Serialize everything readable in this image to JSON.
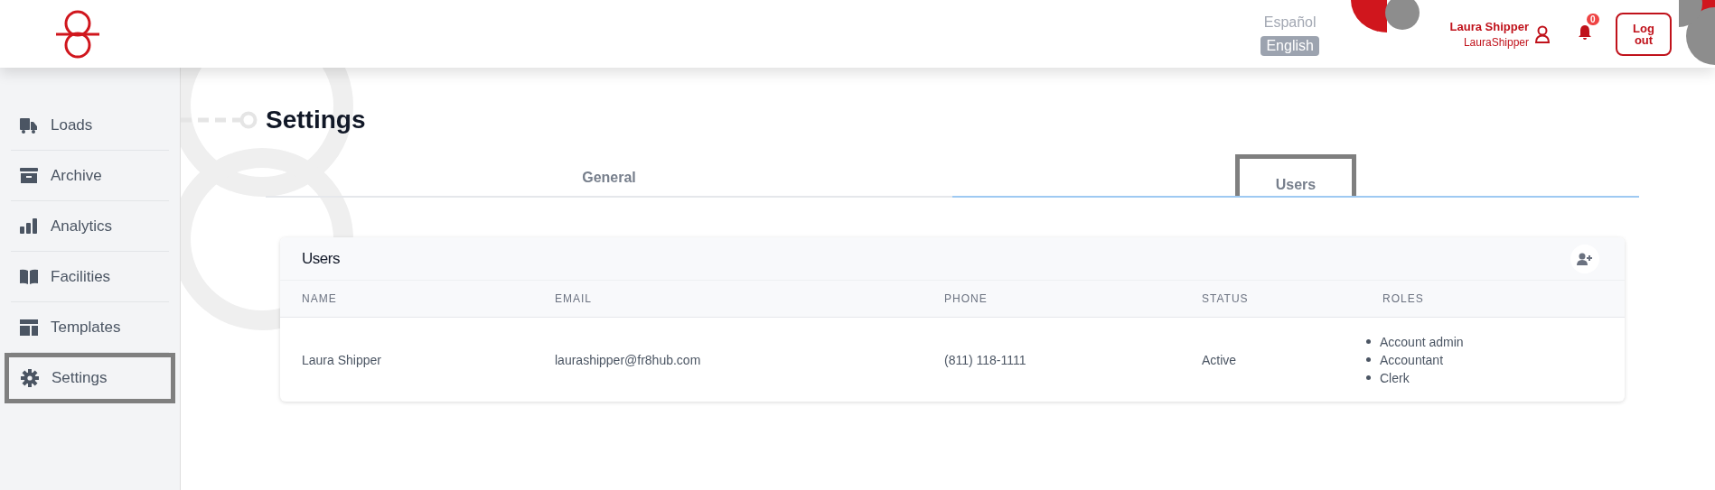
{
  "header": {
    "languages": [
      {
        "label": "Español",
        "selected": false
      },
      {
        "label": "English",
        "selected": true
      }
    ],
    "user": {
      "name": "Laura Shipper",
      "username": "LauraShipper"
    },
    "notifications": {
      "count": "0"
    },
    "logout": "Log out"
  },
  "sidebar": {
    "items": [
      {
        "label": "Loads",
        "selected": false
      },
      {
        "label": "Archive",
        "selected": false
      },
      {
        "label": "Analytics",
        "selected": false
      },
      {
        "label": "Facilities",
        "selected": false
      },
      {
        "label": "Templates",
        "selected": false
      },
      {
        "label": "Settings",
        "selected": true
      }
    ]
  },
  "page": {
    "title": "Settings"
  },
  "tabs": [
    {
      "label": "General",
      "selected": false
    },
    {
      "label": "Users",
      "selected": true
    }
  ],
  "users_card": {
    "title": "Users",
    "columns": [
      "NAME",
      "EMAIL",
      "PHONE",
      "STATUS",
      "ROLES"
    ],
    "rows": [
      {
        "name": "Laura Shipper",
        "email": "laurashipper@fr8hub.com",
        "phone": "(811) 118-1111",
        "status": "Active",
        "roles": [
          "Account admin",
          "Accountant",
          "Clerk"
        ]
      }
    ]
  }
}
